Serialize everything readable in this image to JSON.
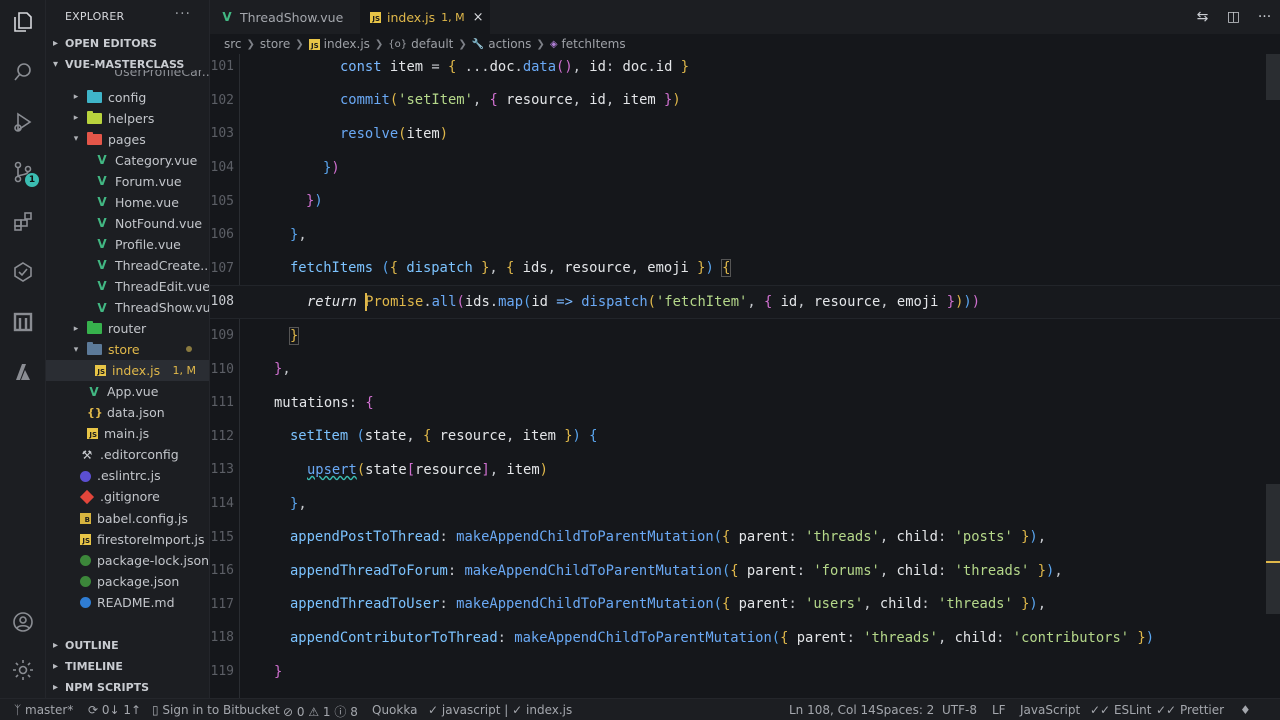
{
  "sidebar": {
    "title": "EXPLORER",
    "more": "···",
    "open_editors": "OPEN EDITORS",
    "project": "VUE-MASTERCLASS",
    "partial_top": "UserProfileCar...",
    "rows": [
      {
        "label": "config",
        "icon": "folder",
        "color": "#3fb5c9"
      },
      {
        "label": "helpers",
        "icon": "folder",
        "color": "#b9d33d"
      },
      {
        "label": "pages",
        "icon": "folder-open",
        "color": "#e45649"
      },
      {
        "label": "Category.vue",
        "icon": "vue"
      },
      {
        "label": "Forum.vue",
        "icon": "vue"
      },
      {
        "label": "Home.vue",
        "icon": "vue"
      },
      {
        "label": "NotFound.vue",
        "icon": "vue"
      },
      {
        "label": "Profile.vue",
        "icon": "vue"
      },
      {
        "label": "ThreadCreate....",
        "icon": "vue"
      },
      {
        "label": "ThreadEdit.vue",
        "icon": "vue"
      },
      {
        "label": "ThreadShow.vue",
        "icon": "vue"
      },
      {
        "label": "router",
        "icon": "folder",
        "color": "#37b24d"
      },
      {
        "label": "store",
        "icon": "folder-open",
        "color": "#5c7a99"
      },
      {
        "label": "index.js",
        "icon": "js",
        "badge": "1, M"
      },
      {
        "label": "App.vue",
        "icon": "vue"
      },
      {
        "label": "data.json",
        "icon": "json"
      },
      {
        "label": "main.js",
        "icon": "js"
      },
      {
        "label": ".editorconfig",
        "icon": "gear"
      },
      {
        "label": ".eslintrc.js",
        "icon": "eslint"
      },
      {
        "label": ".gitignore",
        "icon": "git"
      },
      {
        "label": "babel.config.js",
        "icon": "babel"
      },
      {
        "label": "firestoreImport.js",
        "icon": "js"
      },
      {
        "label": "package-lock.json",
        "icon": "npm"
      },
      {
        "label": "package.json",
        "icon": "npm"
      },
      {
        "label": "README.md",
        "icon": "info"
      }
    ],
    "outline": "OUTLINE",
    "timeline": "TIMELINE",
    "npm_scripts": "NPM SCRIPTS"
  },
  "activity": {
    "scm_badge": "1"
  },
  "tabs": [
    {
      "label": "ThreadShow.vue",
      "active": false
    },
    {
      "label": "index.js",
      "active": true,
      "status": "1, M",
      "close": "×"
    }
  ],
  "breadcrumb": [
    "src",
    "store",
    "index.js",
    "default",
    "actions",
    "fetchItems"
  ],
  "editor": {
    "line_numbers": [
      "101",
      "102",
      "103",
      "104",
      "105",
      "106",
      "107",
      "108",
      "109",
      "110",
      "111",
      "112",
      "113",
      "114",
      "115",
      "116",
      "117",
      "118",
      "119"
    ],
    "current_line": "108"
  },
  "statusbar": {
    "branch": "master*",
    "sync": "0↓ 1↑",
    "bitbucket": "Sign in to Bitbucket",
    "errors": "0",
    "warnings": "1",
    "info": "8",
    "quokka": "Quokka",
    "lang_ctx": "javascript |",
    "file_ctx": "index.js",
    "position": "Ln 108, Col 14",
    "spaces": "Spaces: 2",
    "encoding": "UTF-8",
    "eol": "LF",
    "language": "JavaScript",
    "eslint": "ESLint",
    "prettier": "Prettier"
  },
  "colors": {
    "accent": "#e0b84a",
    "vue": "#42b883",
    "badge": "#3bbdb2"
  }
}
